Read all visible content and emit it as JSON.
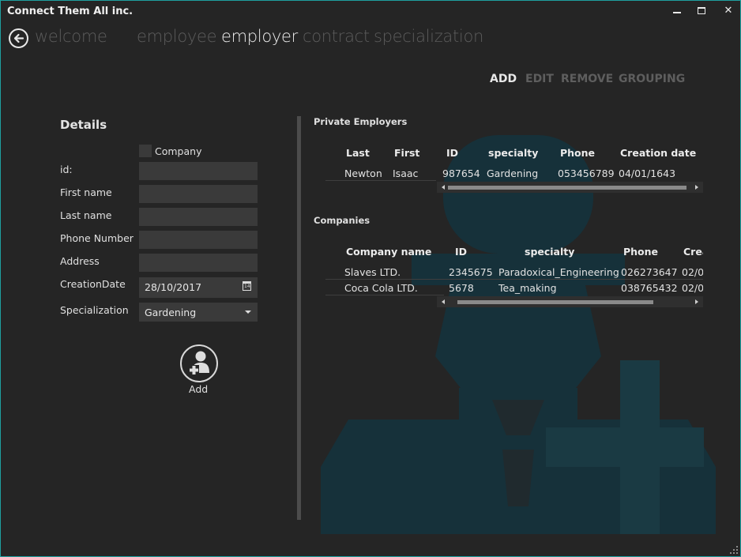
{
  "app": {
    "title": "Connect Them All inc."
  },
  "nav": {
    "items": [
      {
        "label": "welcome"
      },
      {
        "label": "employee"
      },
      {
        "label": "employer"
      },
      {
        "label": "contract"
      },
      {
        "label": "specialization"
      }
    ],
    "active": "employer"
  },
  "commands": {
    "add": "ADD",
    "edit": "EDIT",
    "remove": "REMOVE",
    "grouping": "GROUPING"
  },
  "details": {
    "title": "Details",
    "company_label": "Company",
    "id_label": "id:",
    "first_name_label": "First name",
    "last_name_label": "Last name",
    "phone_label": "Phone Number",
    "address_label": "Address",
    "creation_date_label": "CreationDate",
    "creation_date_value": "28/10/2017",
    "specialization_label": "Specialization",
    "specialization_value": "Gardening",
    "add_label": "Add"
  },
  "private_employers": {
    "title": "Private Employers",
    "columns": [
      "Last",
      "First",
      "ID",
      "specialty",
      "Phone",
      "Creation date"
    ],
    "rows": [
      [
        "Newton",
        "Isaac",
        "987654",
        "Gardening",
        "053456789",
        "04/01/1643"
      ]
    ]
  },
  "companies": {
    "title": "Companies",
    "columns": [
      "Company name",
      "ID",
      "specialty",
      "Phone",
      "Crea"
    ],
    "rows": [
      [
        "Slaves LTD.",
        "2345675",
        "Paradoxical_Engineering",
        "026273647",
        "02/0"
      ],
      [
        "Coca Cola LTD.",
        "5678",
        "Tea_making",
        "038765432",
        "02/0"
      ]
    ]
  },
  "colors": {
    "accent_border": "#1fa0a0",
    "background": "#252525",
    "watermark": "#163038"
  }
}
